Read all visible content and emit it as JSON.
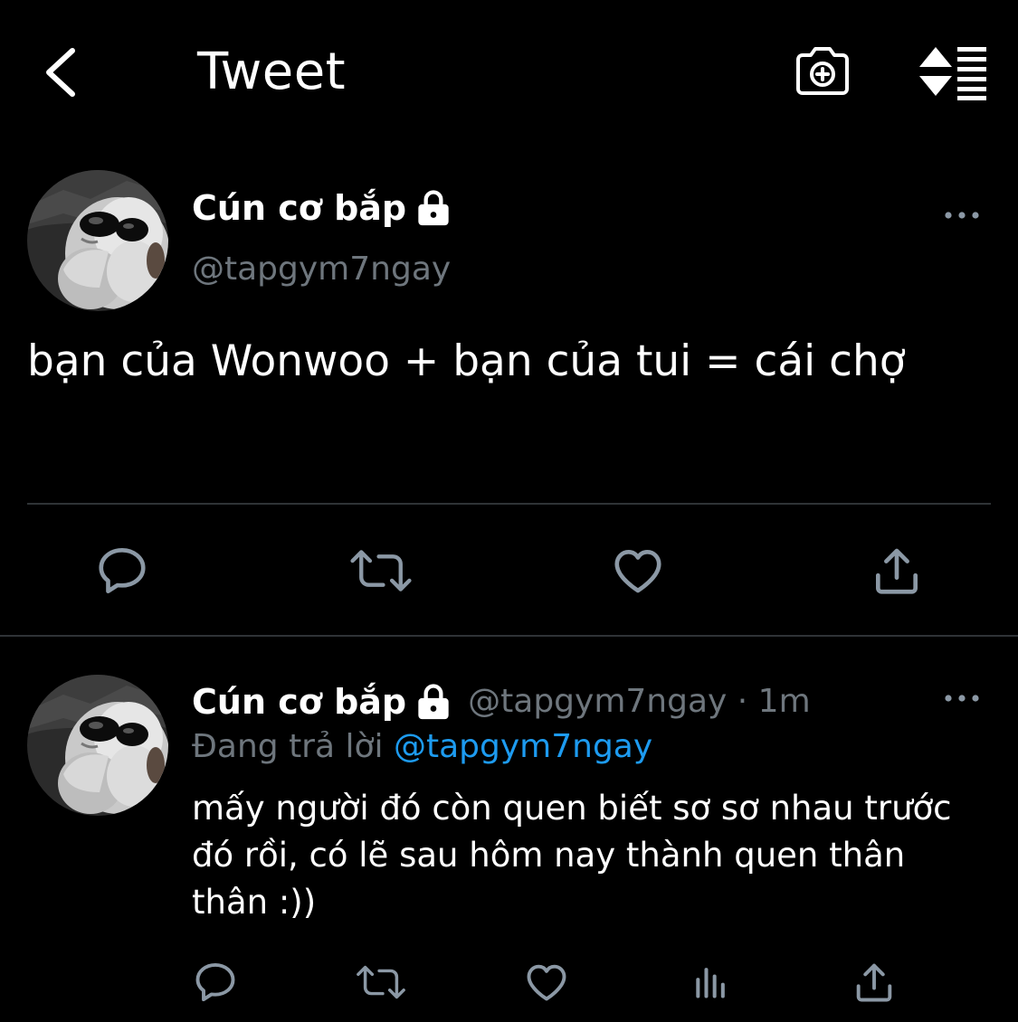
{
  "header": {
    "title": "Tweet",
    "icons": [
      "back-arrow-icon",
      "camera-add-icon",
      "sort-lines-icon"
    ]
  },
  "main_tweet": {
    "author": {
      "display_name": "Cún cơ bắp",
      "handle": "@tapgym7ngay",
      "locked": true
    },
    "text": "bạn của Wonwoo + bạn của tui = cái chợ",
    "actions": [
      "reply-icon",
      "retweet-icon",
      "like-icon",
      "share-icon"
    ]
  },
  "reply_tweet": {
    "author": {
      "display_name": "Cún cơ bắp",
      "handle_time": "@tapgym7ngay · 1m",
      "locked": true
    },
    "replying_prefix": "Đang trả lời",
    "replying_to": "@tapgym7ngay",
    "text": "mấy người đó còn quen biết sơ sơ nhau trước đó rồi, có lẽ sau hôm nay thành quen thân thân :))",
    "actions": [
      "reply-icon",
      "retweet-icon",
      "like-icon",
      "stats-icon",
      "share-icon"
    ]
  },
  "colors": {
    "background": "#000000",
    "text": "#ffffff",
    "secondary": "#6e767d",
    "icon": "#8b98a5",
    "link": "#1d9bf0",
    "divider": "#2f3336"
  }
}
